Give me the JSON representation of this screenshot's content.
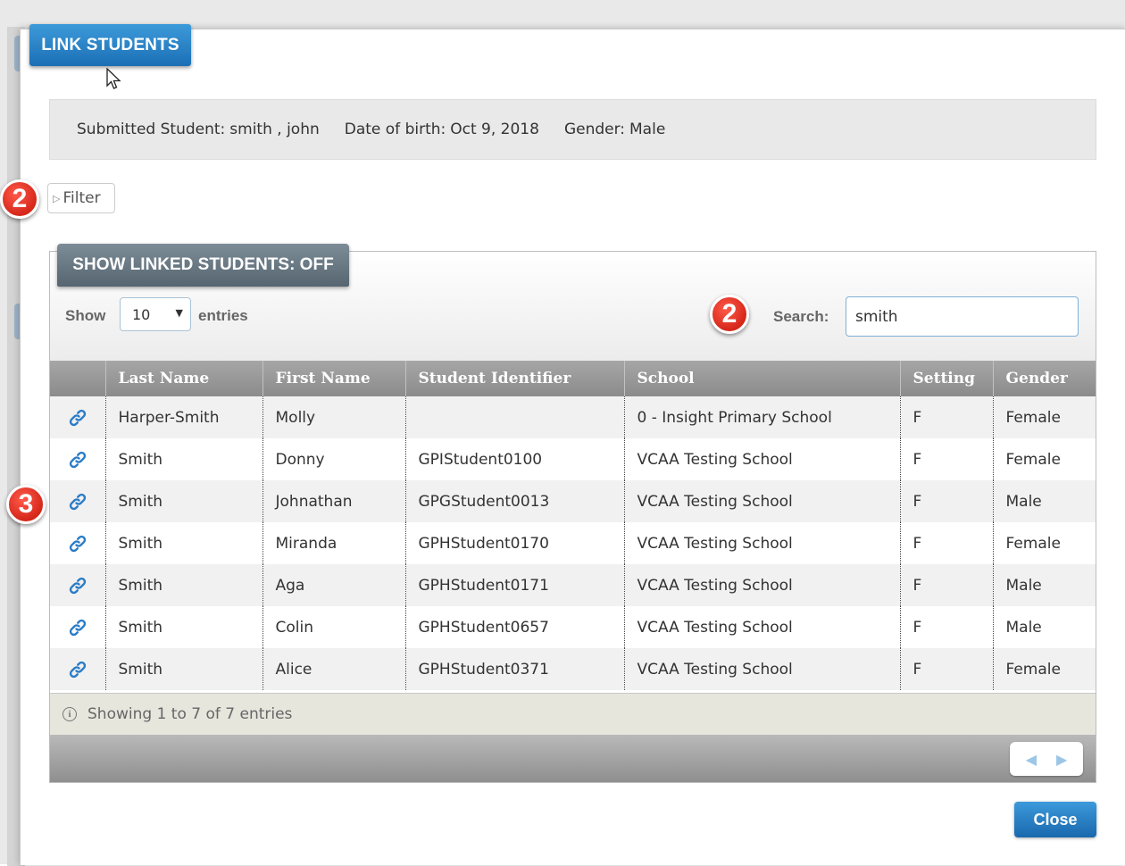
{
  "dialog": {
    "title": "LINK STUDENTS",
    "close_label": "Close"
  },
  "submitted": {
    "student_label": "Submitted Student:",
    "student_value": "smith , john",
    "dob_label": "Date of birth:",
    "dob_value": "Oct 9, 2018",
    "gender_label": "Gender:",
    "gender_value": "Male"
  },
  "filter": {
    "label": "Filter"
  },
  "callouts": {
    "filter": "2",
    "search": "2",
    "row": "3"
  },
  "toggle": {
    "label": "SHOW LINKED STUDENTS: OFF"
  },
  "length": {
    "show_label": "Show",
    "value": "10",
    "entries_label": "entries"
  },
  "search": {
    "label": "Search:",
    "value": "smith"
  },
  "table": {
    "columns": [
      "",
      "Last Name",
      "First Name",
      "Student Identifier",
      "School",
      "Setting",
      "Gender"
    ],
    "rows": [
      {
        "last": "Harper-Smith",
        "first": "Molly",
        "id": "",
        "school": "0 - Insight Primary School",
        "setting": "F",
        "gender": "Female"
      },
      {
        "last": "Smith",
        "first": "Donny",
        "id": "GPIStudent0100",
        "school": "VCAA Testing School",
        "setting": "F",
        "gender": "Female"
      },
      {
        "last": "Smith",
        "first": "Johnathan",
        "id": "GPGStudent0013",
        "school": "VCAA Testing School",
        "setting": "F",
        "gender": "Male"
      },
      {
        "last": "Smith",
        "first": "Miranda",
        "id": "GPHStudent0170",
        "school": "VCAA Testing School",
        "setting": "F",
        "gender": "Female"
      },
      {
        "last": "Smith",
        "first": "Aga",
        "id": "GPHStudent0171",
        "school": "VCAA Testing School",
        "setting": "F",
        "gender": "Male"
      },
      {
        "last": "Smith",
        "first": "Colin",
        "id": "GPHStudent0657",
        "school": "VCAA Testing School",
        "setting": "F",
        "gender": "Male"
      },
      {
        "last": "Smith",
        "first": "Alice",
        "id": "GPHStudent0371",
        "school": "VCAA Testing School",
        "setting": "F",
        "gender": "Female"
      }
    ],
    "info": "Showing 1 to 7 of 7 entries"
  },
  "colors": {
    "primary_button": "#1b6fb5",
    "header_gray": "#8b8b8b",
    "callout_red": "#d5271a",
    "link_icon": "#2a7cc7"
  },
  "icons": {
    "link": "link-icon",
    "info": "info-icon",
    "prev": "chevron-left-icon",
    "next": "chevron-right-icon",
    "filter": "triangle-right-icon"
  }
}
